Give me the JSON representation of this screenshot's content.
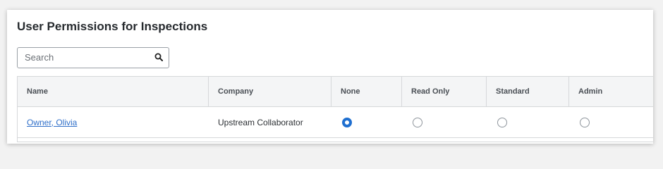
{
  "title": "User Permissions for Inspections",
  "search": {
    "placeholder": "Search",
    "value": "",
    "icon": "search-icon"
  },
  "table": {
    "columns": [
      "Name",
      "Company",
      "None",
      "Read Only",
      "Standard",
      "Admin"
    ],
    "rows": [
      {
        "name": "Owner, Olivia",
        "company": "Upstream Collaborator",
        "permission": "None"
      }
    ]
  },
  "colors": {
    "accent": "#1f6fd0",
    "link": "#2f6fc9",
    "header_bg": "#f4f5f6"
  }
}
